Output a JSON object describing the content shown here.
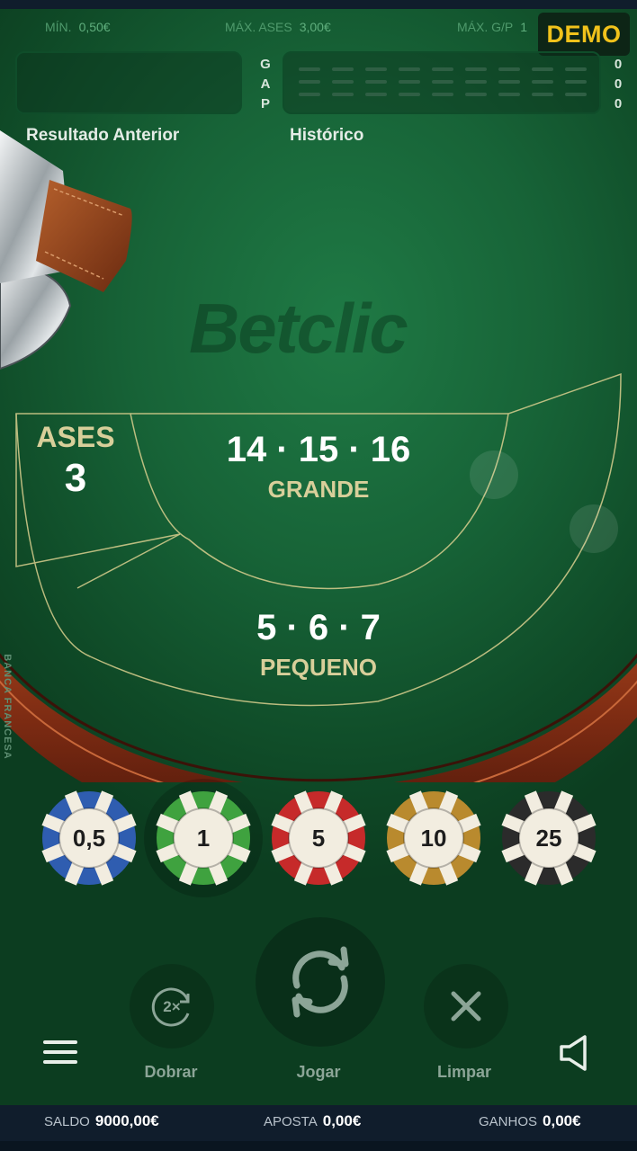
{
  "limits": {
    "min_label": "MÍN.",
    "min_value": "0,50€",
    "max_ases_label": "MÁX. ASES",
    "max_ases_value": "3,00€",
    "max_gp_label": "MÁX. G/P",
    "max_gp_value": "1"
  },
  "demo_badge": "DEMO",
  "gap": {
    "letters": [
      "G",
      "A",
      "P"
    ],
    "counts": [
      "0",
      "0",
      "0"
    ]
  },
  "previous_result_label": "Resultado Anterior",
  "history_label": "Histórico",
  "watermark": "Betclic",
  "bets": {
    "ases": {
      "title": "ASES",
      "number": "3"
    },
    "grande": {
      "numbers": "14 · 15 · 16",
      "title": "GRANDE"
    },
    "pequeno": {
      "numbers": "5 · 6 · 7",
      "title": "PEQUENO"
    }
  },
  "side_label": "BANCA FRANCESA",
  "chips": [
    {
      "value": "0,5",
      "color": "#2f5db0",
      "selected": false
    },
    {
      "value": "1",
      "color": "#3fa23f",
      "selected": true
    },
    {
      "value": "5",
      "color": "#c62a2a",
      "selected": false
    },
    {
      "value": "10",
      "color": "#b98a2e",
      "selected": false
    },
    {
      "value": "25",
      "color": "#2b2b2b",
      "selected": false
    }
  ],
  "actions": {
    "double": "Dobrar",
    "play": "Jogar",
    "clear": "Limpar"
  },
  "icons": {
    "menu": "hamburger-icon",
    "sound": "speaker-icon",
    "double": "double-2x-icon",
    "play": "refresh-icon",
    "clear": "close-icon"
  },
  "status": {
    "balance_label": "SALDO",
    "balance_value": "9000,00€",
    "bet_label": "APOSTA",
    "bet_value": "0,00€",
    "winnings_label": "GANHOS",
    "winnings_value": "0,00€"
  },
  "colors": {
    "felt": "#176337",
    "rail": "#7a2a12",
    "accent": "#f1c21b",
    "bet_title": "#d8cf9a"
  }
}
